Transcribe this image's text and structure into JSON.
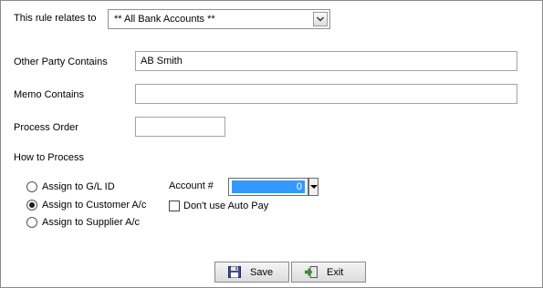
{
  "rule": {
    "label": "This rule relates to",
    "value": "** All Bank Accounts **"
  },
  "other_party": {
    "label": "Other Party Contains",
    "value": "AB Smith"
  },
  "memo": {
    "label": "Memo Contains",
    "value": ""
  },
  "process_order": {
    "label": "Process Order",
    "value": ""
  },
  "how_to_process": {
    "label": "How to Process",
    "options": [
      {
        "label": "Assign to G/L ID",
        "selected": false
      },
      {
        "label": "Assign to Customer A/c",
        "selected": true
      },
      {
        "label": "Assign to Supplier A/c",
        "selected": false
      }
    ]
  },
  "account": {
    "label": "Account #",
    "value": "0"
  },
  "auto_pay": {
    "label": "Don't use Auto Pay",
    "checked": false
  },
  "buttons": {
    "save": "Save",
    "exit": "Exit"
  },
  "icons": {
    "save": "floppy-disk-icon",
    "exit": "exit-door-icon",
    "dropdown": "chevron-down-icon"
  },
  "colors": {
    "selection": "#3399ff"
  }
}
